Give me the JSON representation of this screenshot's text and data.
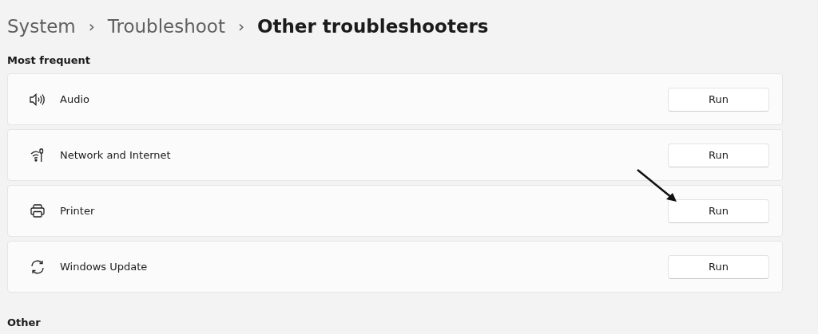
{
  "breadcrumb": [
    {
      "label": "System",
      "current": false
    },
    {
      "label": "Troubleshoot",
      "current": false
    },
    {
      "label": "Other troubleshooters",
      "current": true
    }
  ],
  "separator": "›",
  "sections": [
    {
      "title": "Most frequent",
      "items": [
        {
          "kind": "audio",
          "label": "Audio",
          "button": "Run",
          "pointed": false
        },
        {
          "kind": "network",
          "label": "Network and Internet",
          "button": "Run",
          "pointed": false
        },
        {
          "kind": "printer",
          "label": "Printer",
          "button": "Run",
          "pointed": true
        },
        {
          "kind": "update",
          "label": "Windows Update",
          "button": "Run",
          "pointed": false
        }
      ]
    },
    {
      "title": "Other"
    }
  ]
}
